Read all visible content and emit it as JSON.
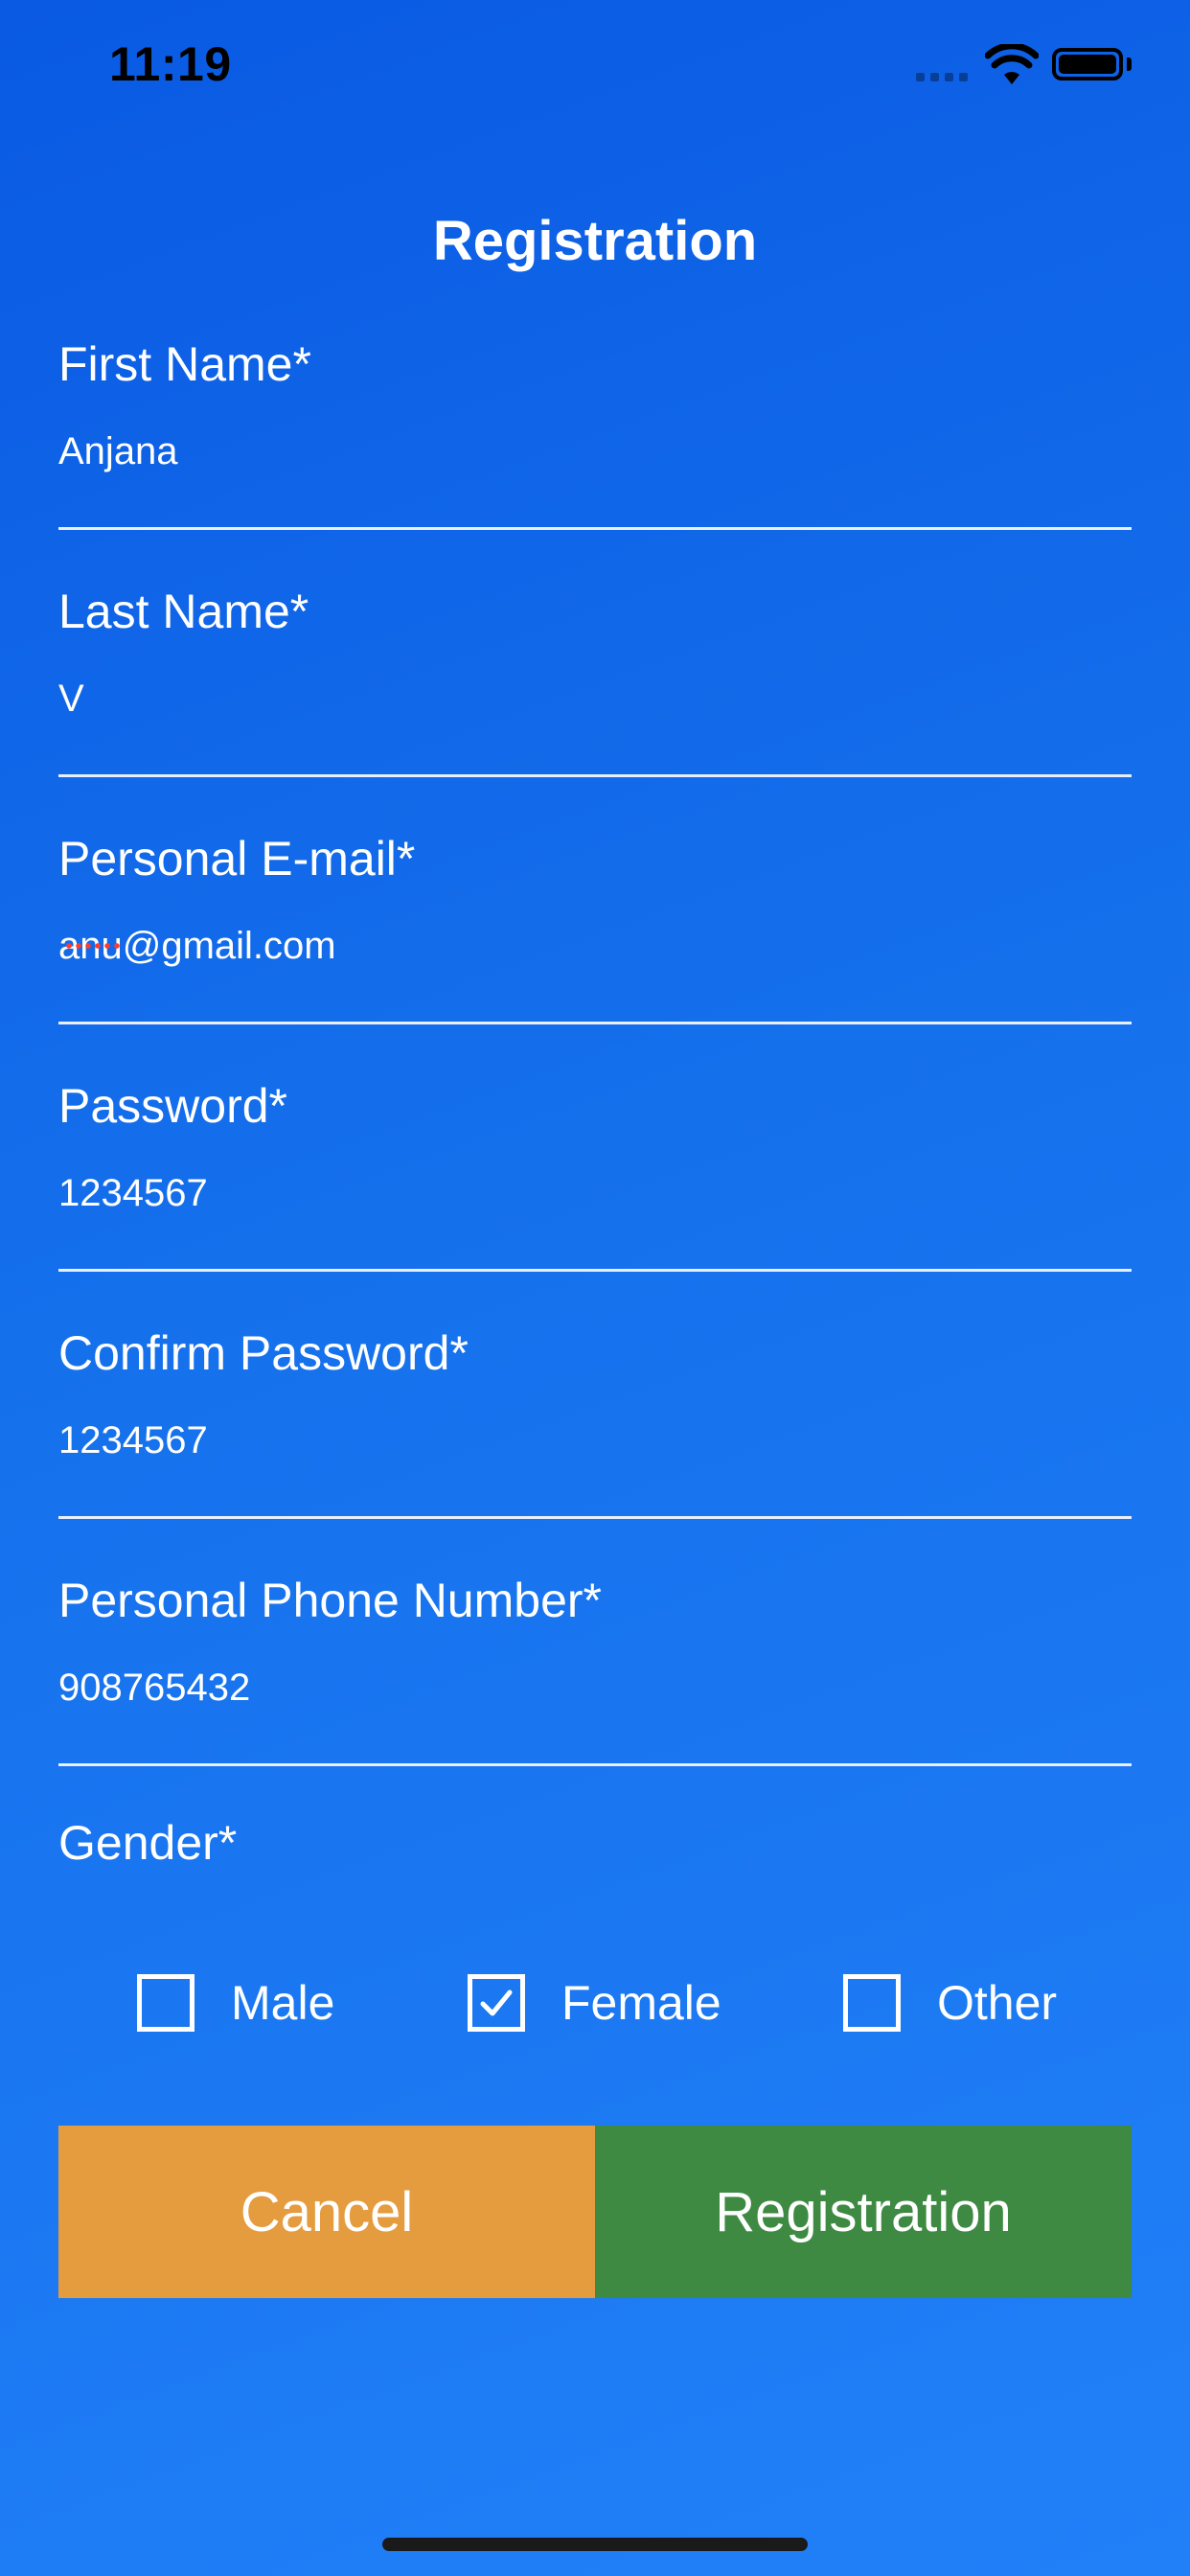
{
  "status_bar": {
    "time": "11:19"
  },
  "header": {
    "title": "Registration"
  },
  "form": {
    "fields": [
      {
        "label": "First Name*",
        "value": "Anjana"
      },
      {
        "label": "Last Name*",
        "value": "V"
      },
      {
        "label": "Personal E-mail*",
        "value": "anu@gmail.com"
      },
      {
        "label": "Password*",
        "value": "1234567"
      },
      {
        "label": "Confirm Password*",
        "value": "1234567"
      },
      {
        "label": "Personal Phone Number*",
        "value": "908765432"
      }
    ],
    "gender": {
      "label": "Gender*",
      "options": [
        {
          "label": "Male",
          "checked": false
        },
        {
          "label": "Female",
          "checked": true
        },
        {
          "label": "Other",
          "checked": false
        }
      ]
    }
  },
  "actions": {
    "cancel_label": "Cancel",
    "register_label": "Registration"
  },
  "colors": {
    "background_top": "#0a5ae3",
    "background_bottom": "#2180f8",
    "cancel_button": "#e59c3f",
    "register_button": "#3e8a43"
  }
}
